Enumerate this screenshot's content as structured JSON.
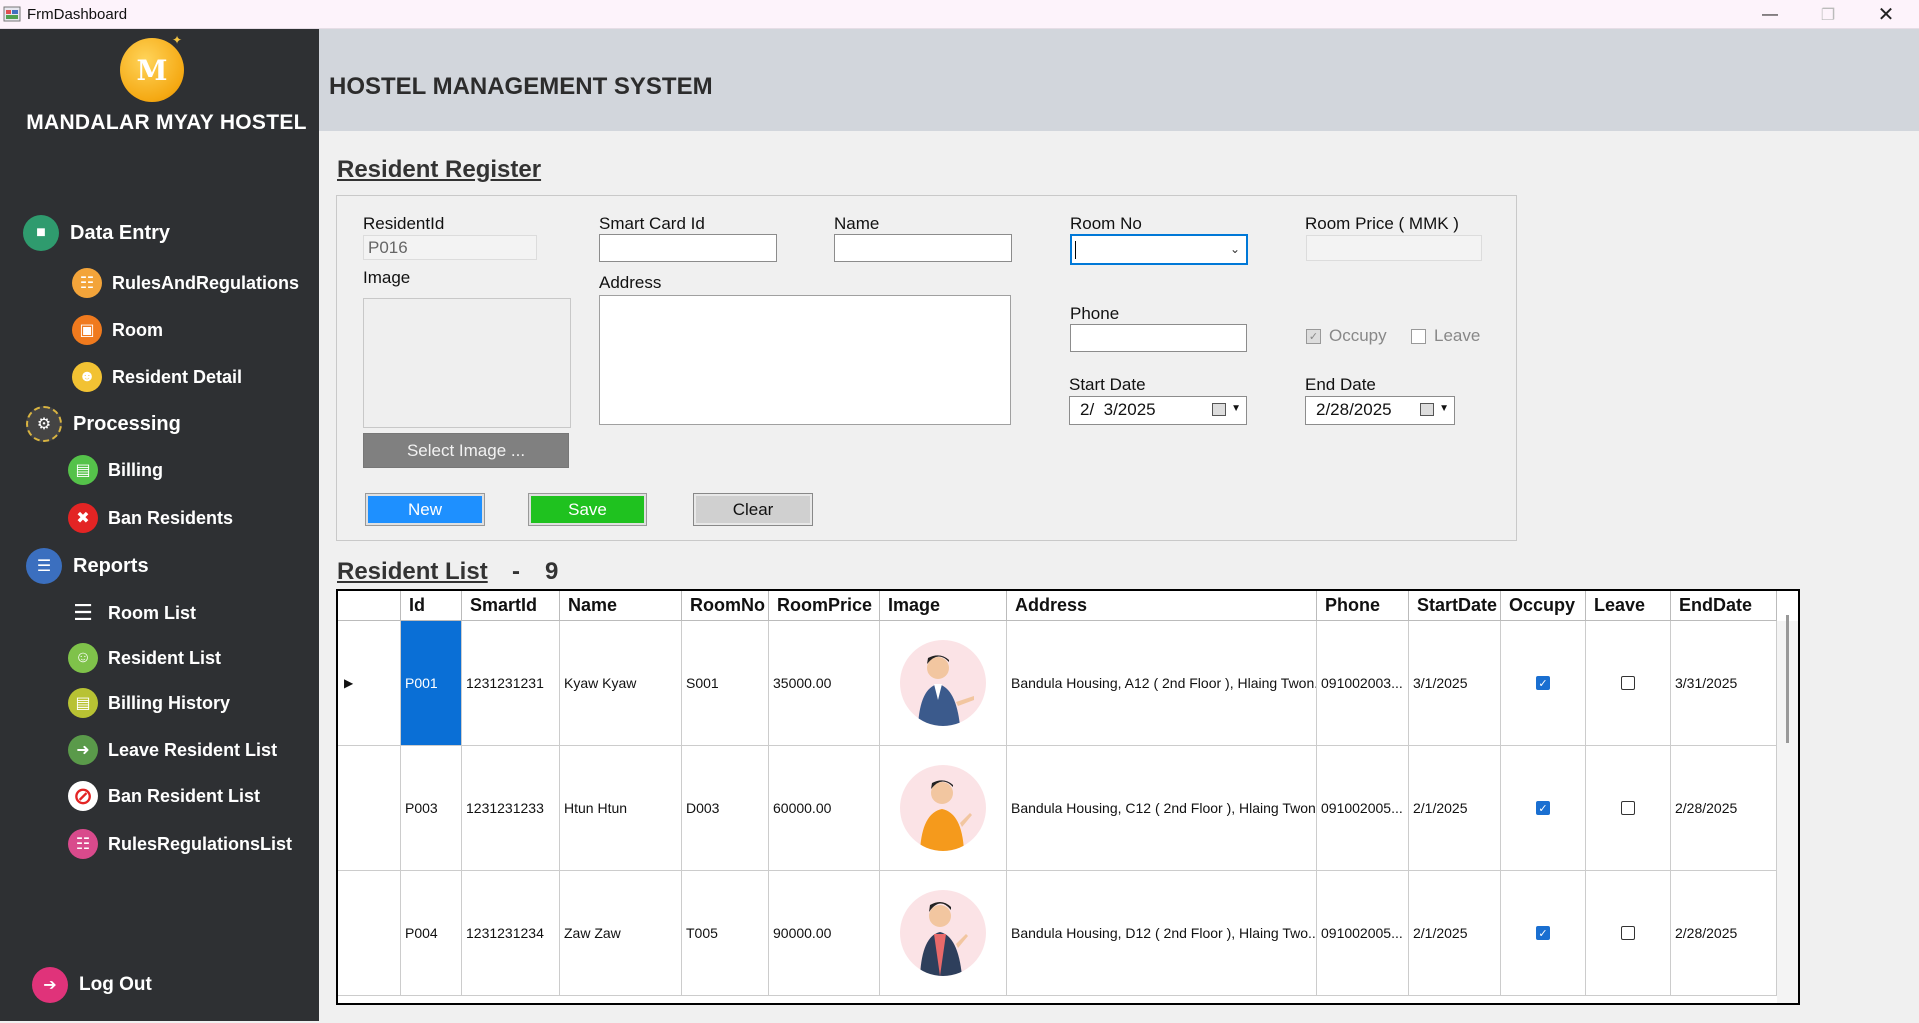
{
  "window": {
    "title": "FrmDashboard"
  },
  "sidebar": {
    "brand": "MANDALAR MYAY HOSTEL",
    "logo_icon": "hostel-logo-icon",
    "sections": [
      {
        "label": "Data Entry",
        "icon": "data-entry-icon",
        "items": [
          {
            "label": "RulesAndRegulations",
            "icon": "rules-icon"
          },
          {
            "label": "Room",
            "icon": "room-icon"
          },
          {
            "label": "Resident Detail",
            "icon": "resident-icon"
          }
        ]
      },
      {
        "label": "Processing",
        "icon": "gears-icon",
        "items": [
          {
            "label": "Billing",
            "icon": "billing-icon"
          },
          {
            "label": "Ban Residents",
            "icon": "ban-residents-icon"
          }
        ]
      },
      {
        "label": "Reports",
        "icon": "reports-icon",
        "items": [
          {
            "label": "Room List",
            "icon": "list-icon"
          },
          {
            "label": "Resident List",
            "icon": "resident-list-icon"
          },
          {
            "label": "Billing History",
            "icon": "billing-history-icon"
          },
          {
            "label": "Leave Resident List",
            "icon": "leave-icon"
          },
          {
            "label": "Ban Resident List",
            "icon": "ban-icon"
          },
          {
            "label": "RulesRegulationsList",
            "icon": "rules-list-icon"
          }
        ]
      }
    ],
    "logout": {
      "label": "Log Out",
      "icon": "logout-icon"
    }
  },
  "header": {
    "title": "HOSTEL MANAGEMENT SYSTEM"
  },
  "form": {
    "title": "Resident Register",
    "resident_id_label": "ResidentId",
    "resident_id_value": "P016",
    "smart_card_label": "Smart Card Id",
    "smart_card_value": "",
    "name_label": "Name",
    "name_value": "",
    "room_no_label": "Room No",
    "room_no_value": "",
    "room_price_label": "Room Price ( MMK )",
    "room_price_value": "",
    "image_label": "Image",
    "address_label": "Address",
    "address_value": "",
    "phone_label": "Phone",
    "phone_value": "",
    "occupy_label": "Occupy",
    "leave_label": "Leave",
    "start_date_label": "Start Date",
    "start_date_value": "2/  3/2025",
    "end_date_label": "End Date",
    "end_date_value": "2/28/2025",
    "select_image_label": "Select Image ...",
    "new_label": "New",
    "save_label": "Save",
    "clear_label": "Clear"
  },
  "list": {
    "title": "Resident List",
    "separator": "-",
    "count": "9",
    "columns": [
      "Id",
      "SmartId",
      "Name",
      "RoomNo",
      "RoomPrice",
      "Image",
      "Address",
      "Phone",
      "StartDate",
      "Occupy",
      "Leave",
      "EndDate"
    ],
    "rows": [
      {
        "id": "P001",
        "smart_id": "1231231231",
        "name": "Kyaw Kyaw",
        "room_no": "S001",
        "room_price": "35000.00",
        "address": "Bandula Housing, A12 ( 2nd Floor ), Hlaing Twon...",
        "phone": "091002003...",
        "start_date": "3/1/2025",
        "occupy": true,
        "leave": false,
        "end_date": "3/31/2025",
        "avatar_shirt": "#3b5a8c"
      },
      {
        "id": "P003",
        "smart_id": "1231231233",
        "name": "Htun Htun",
        "room_no": "D003",
        "room_price": "60000.00",
        "address": "Bandula Housing, C12 ( 2nd Floor ), Hlaing Twon...",
        "phone": "091002005...",
        "start_date": "2/1/2025",
        "occupy": true,
        "leave": false,
        "end_date": "2/28/2025",
        "avatar_shirt": "#f59a1c"
      },
      {
        "id": "P004",
        "smart_id": "1231231234",
        "name": "Zaw Zaw",
        "room_no": "T005",
        "room_price": "90000.00",
        "address": "Bandula Housing, D12 ( 2nd Floor ), Hlaing Two...",
        "phone": "091002005...",
        "start_date": "2/1/2025",
        "occupy": true,
        "leave": false,
        "end_date": "2/28/2025",
        "avatar_shirt": "#2e3f5c"
      }
    ]
  },
  "colors": {
    "sidebar_bg": "#2e3033",
    "header_bg": "#d2d6dc",
    "new_button": "#1e90ff",
    "save_button": "#1fc21f",
    "clear_button": "#d0d0d0",
    "selected_cell": "#0a6fd6"
  }
}
